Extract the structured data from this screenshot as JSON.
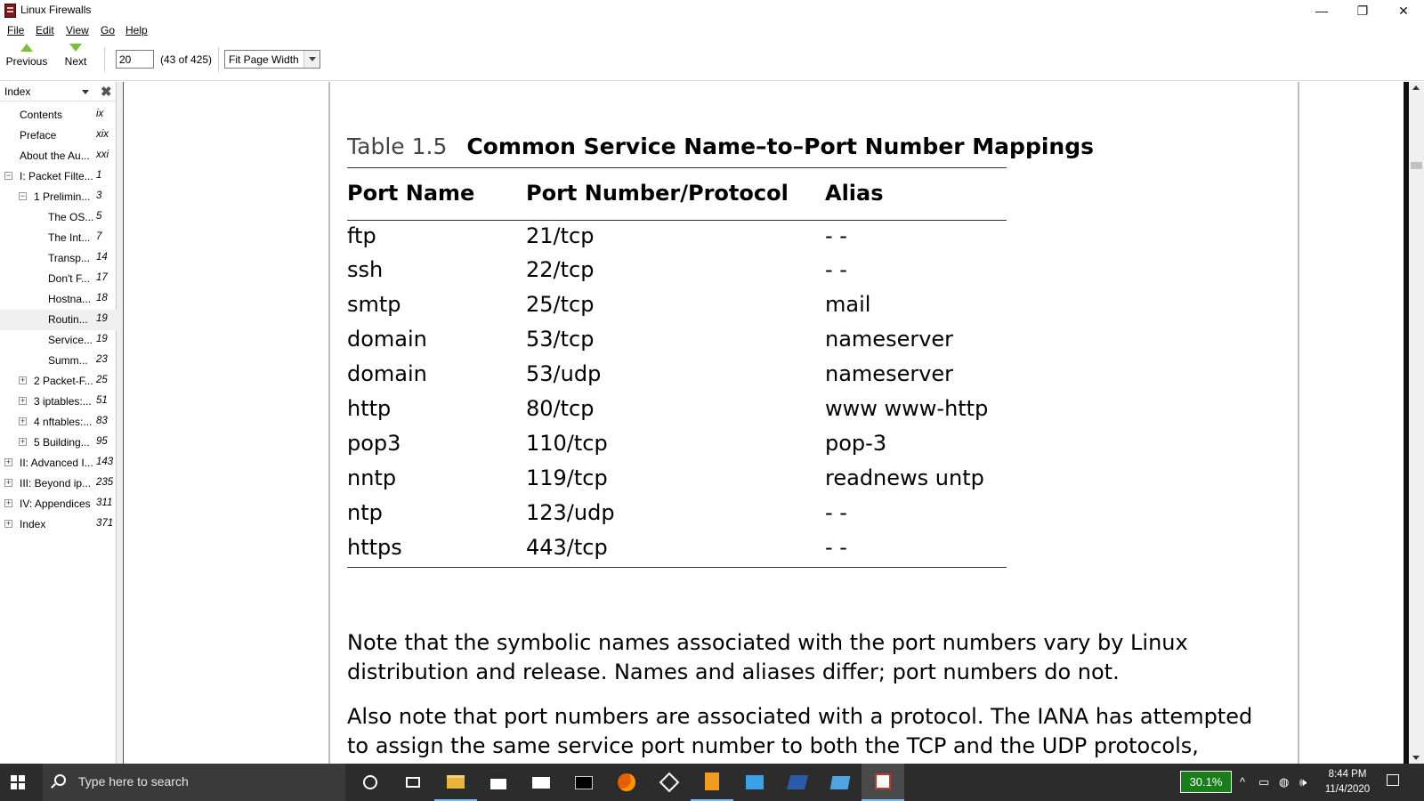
{
  "window": {
    "title": "Linux Firewalls",
    "minimize": "—",
    "restore": "❐",
    "close": "✕"
  },
  "menu": [
    {
      "label": "File"
    },
    {
      "label": "Edit"
    },
    {
      "label": "View"
    },
    {
      "label": "Go"
    },
    {
      "label": "Help"
    }
  ],
  "toolbar": {
    "previous_label": "Previous",
    "next_label": "Next",
    "page_value": "20",
    "page_count": "(43 of 425)",
    "zoom_value": "Fit Page Width"
  },
  "sidebar": {
    "title": "Index",
    "items": [
      {
        "label": "Contents",
        "page": "ix"
      },
      {
        "label": "Preface",
        "page": "xix"
      },
      {
        "label": "About the Au...",
        "page": "xxi"
      },
      {
        "label": "I: Packet Filte...",
        "page": "1"
      },
      {
        "label": "1 Prelimin...",
        "page": "3"
      },
      {
        "label": "The OS...",
        "page": "5"
      },
      {
        "label": "The Int...",
        "page": "7"
      },
      {
        "label": "Transp...",
        "page": "14"
      },
      {
        "label": "Don't F...",
        "page": "17"
      },
      {
        "label": "Hostna...",
        "page": "18"
      },
      {
        "label": "Routin...",
        "page": "19"
      },
      {
        "label": "Service...",
        "page": "19"
      },
      {
        "label": "Summ...",
        "page": "23"
      },
      {
        "label": "2 Packet-F...",
        "page": "25"
      },
      {
        "label": "3 iptables:...",
        "page": "51"
      },
      {
        "label": "4 nftables:...",
        "page": "83"
      },
      {
        "label": "5 Building...",
        "page": "95"
      },
      {
        "label": "II: Advanced I...",
        "page": "143"
      },
      {
        "label": "III: Beyond ip...",
        "page": "235"
      },
      {
        "label": "IV: Appendices",
        "page": "311"
      },
      {
        "label": "Index",
        "page": "371"
      }
    ]
  },
  "document": {
    "table_number": "Table 1.5",
    "table_title": "Common Service Name–to–Port Number Mappings",
    "headers": [
      "Port Name",
      "Port Number/Protocol",
      "Alias"
    ],
    "rows": [
      [
        "ftp",
        "21/tcp",
        "- -"
      ],
      [
        "ssh",
        "22/tcp",
        "- -"
      ],
      [
        "smtp",
        "25/tcp",
        "mail"
      ],
      [
        "domain",
        "53/tcp",
        "nameserver"
      ],
      [
        "domain",
        "53/udp",
        "nameserver"
      ],
      [
        "http",
        "80/tcp",
        "www www-http"
      ],
      [
        "pop3",
        "110/tcp",
        "pop-3"
      ],
      [
        "nntp",
        "119/tcp",
        "readnews untp"
      ],
      [
        "ntp",
        "123/udp",
        "- -"
      ],
      [
        "https",
        "443/tcp",
        "- -"
      ]
    ],
    "paragraph1": "Note that the symbolic names associated with the port numbers vary by Linux distribution and release. Names and aliases differ; port numbers do not.",
    "paragraph2": "Also note that port numbers are associated with a protocol. The IANA has attempted to assign the same service port number to both the TCP and the UDP protocols, regardless of"
  },
  "taskbar": {
    "search_placeholder": "Type here to search",
    "battery": "30.1%",
    "time": "8:44 PM",
    "date": "11/4/2020"
  }
}
